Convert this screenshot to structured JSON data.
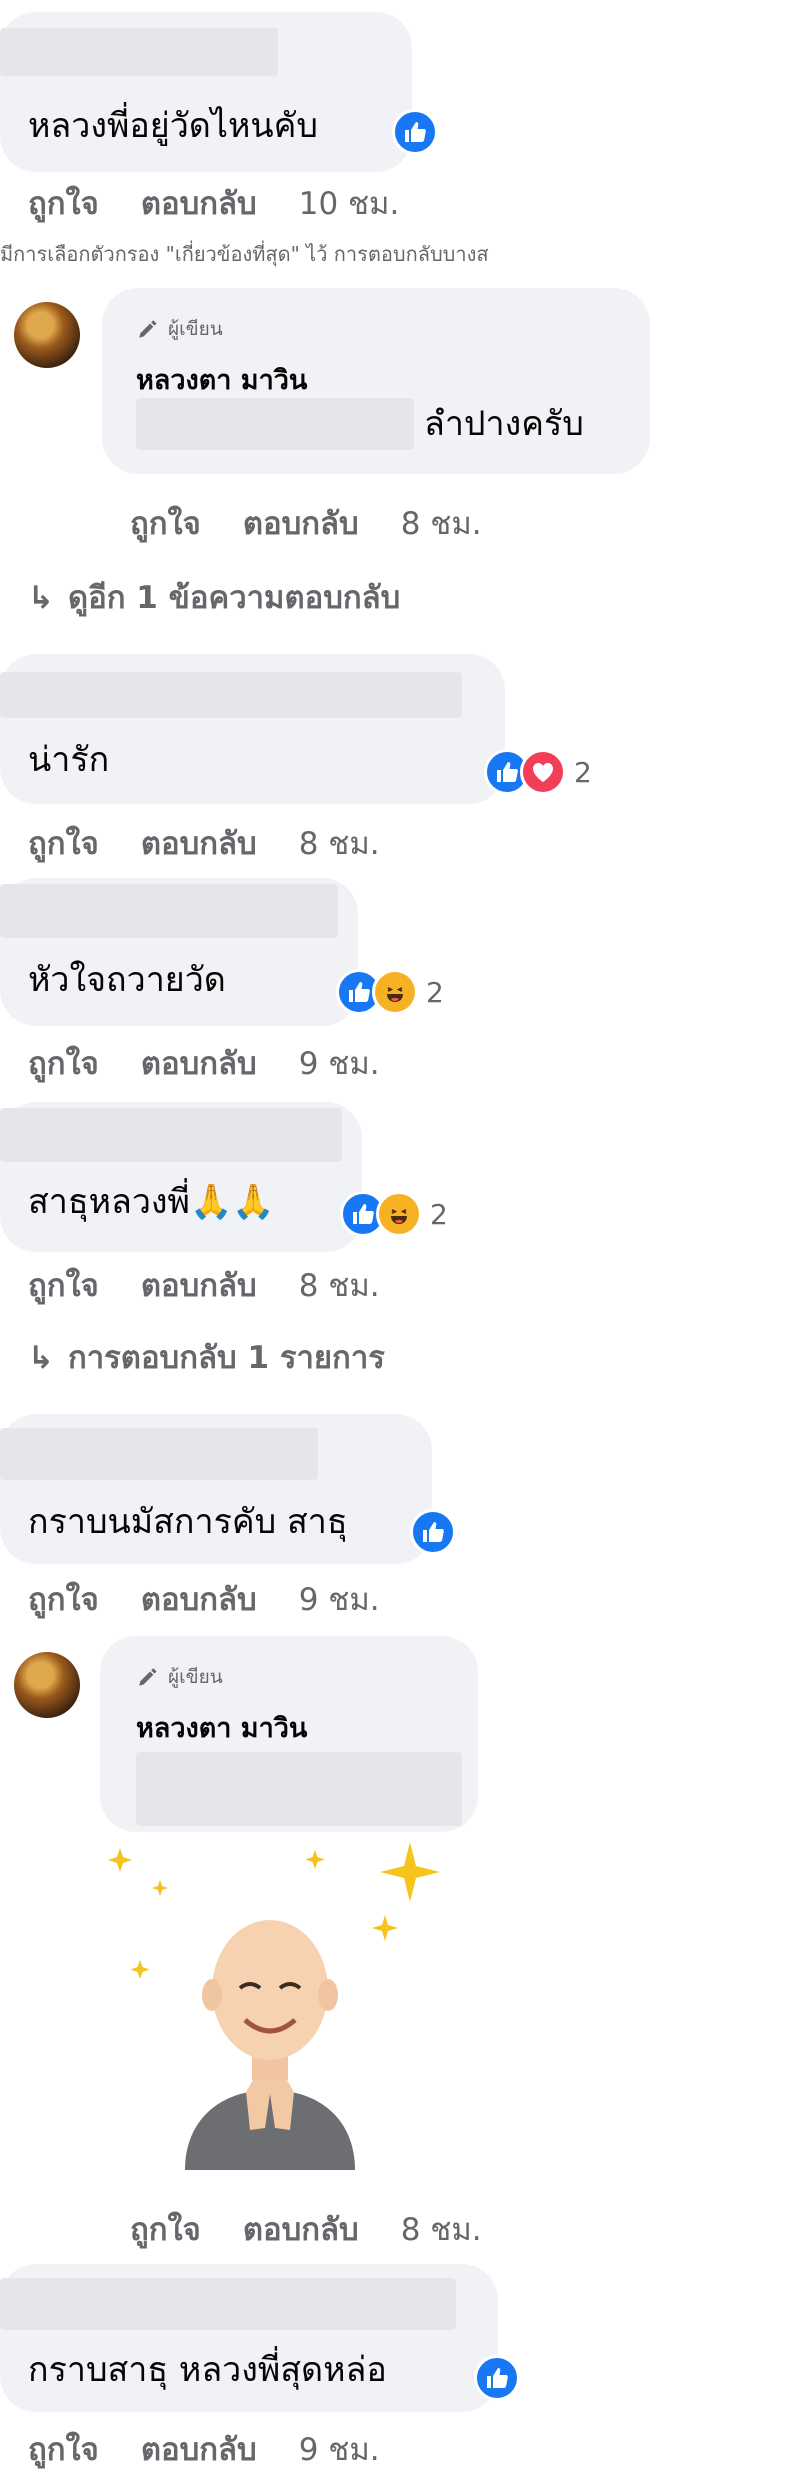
{
  "colors": {
    "like_blue": "#1877f2",
    "love_red": "#f33e58",
    "haha_yellow": "#f7b125",
    "meta_gray": "#65676b",
    "bubble": "#f0f2f5"
  },
  "actions": {
    "like": "ถูกใจ",
    "reply": "ตอบกลับ"
  },
  "filter_note": "มีการเลือกตัวกรอง \"เกี่ยวข้องที่สุด\" ไว้ การตอบกลับบางส",
  "author_badge": "ผู้เขียน",
  "author_name": "หลวงตา มาวิน",
  "comments": [
    {
      "text": "หลวงพี่อยู่วัดไหนคับ",
      "time": "10 ชม.",
      "reactions": [
        "like-icon"
      ]
    },
    {
      "text": "ลำปางครับ",
      "time": "8 ชม.",
      "more": "ดูอีก 1 ข้อความตอบกลับ"
    },
    {
      "text": "น่ารัก",
      "time": "8 ชม.",
      "reactions": [
        "like-icon",
        "love-icon"
      ],
      "count": "2"
    },
    {
      "text": "หัวใจถวายวัด",
      "time": "9 ชม.",
      "reactions": [
        "like-icon",
        "haha-icon"
      ],
      "count": "2"
    },
    {
      "text": "สาธุหลวงพี่",
      "time": "8 ชม.",
      "reactions": [
        "like-icon",
        "haha-icon"
      ],
      "count": "2",
      "more": "การตอบกลับ 1 รายการ"
    },
    {
      "text": "กราบนมัสการคับ สาธุ",
      "time": "9 ชม.",
      "reactions": [
        "like-icon"
      ]
    },
    {
      "text": "",
      "time": "8 ชม.",
      "sticker": "praying-monk-sticker"
    },
    {
      "text": "กราบสาธุ หลวงพี่สุดหล่อ",
      "time": "9 ชม.",
      "reactions": [
        "like-icon"
      ]
    }
  ]
}
